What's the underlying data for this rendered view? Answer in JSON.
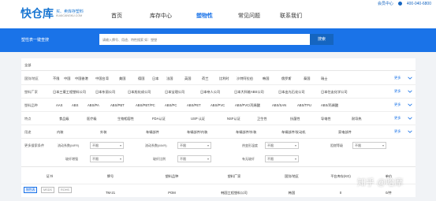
{
  "header": {
    "logo_mark": "快仓库",
    "logo_tagline": "买、卖库存塑料",
    "logo_domain": "KUAICANGKU.COM",
    "nav": [
      "首页",
      "库存中心",
      "塑物性",
      "常见问题",
      "联系我们"
    ],
    "active_nav": "塑物性",
    "member_link": "会员中心",
    "phone": "400-040-6800"
  },
  "search": {
    "title": "塑性表一键查搜",
    "placeholder": "请输入牌号、用途、特性搜索 如：塑塑",
    "button": "搜索"
  },
  "filters": {
    "all_label": "全部",
    "more_label": "更多",
    "rows": [
      {
        "label": "国别/地区",
        "options": [
          "不限",
          "中国",
          "中国香港",
          "中国台湾",
          "美国",
          "德国",
          "日本",
          "法国",
          "英国",
          "荷兰",
          "比利时",
          "沙特阿拉伯",
          "韩国",
          "俄罗斯",
          "泰国",
          "瑞士"
        ]
      },
      {
        "label": "塑料厂家",
        "options": [
          "日本三菱工程塑料公司",
          "日本东丽公司",
          "日本旭化成公司",
          "日本宝理公司",
          "日本帝人公司",
          "日本大科能ABS公司",
          "日本出光石化公司",
          "日本住友化学公司"
        ]
      },
      {
        "label": "塑料品种",
        "options": [
          "AAS",
          "ABS",
          "ABS/PA",
          "ABS/PBT",
          "ABS/PBT/PC",
          "ABS/PC",
          "ABS/PET",
          "ABS/PVC",
          "ABS/PVC/丙烯酸",
          "ABS/SAN",
          "ABS/TPU",
          "ABS/丙烯酸"
        ]
      },
      {
        "label": "特点",
        "options": [
          "食品级",
          "医疗级",
          "生物相容性",
          "FDA认证",
          "USP 认证",
          "NSF认证",
          "卫生性",
          "抗菌性",
          "导电性",
          "耐导热"
        ]
      },
      {
        "label": "用途",
        "options": [
          "内装",
          "外装",
          "车辆部件",
          "车辆部件/内装",
          "车辆部件/外装",
          "车辆部件/发动机",
          "家电部件"
        ]
      }
    ],
    "advanced": {
      "label": "更多搜索条件",
      "fields": [
        {
          "label": "流动系数(MFR)",
          "value": "不限"
        },
        {
          "label": "流动系数(MVR)",
          "value": "不限"
        },
        {
          "label": "热变形温度",
          "value": "不限"
        },
        {
          "label": "阻燃等级",
          "value": "不限"
        },
        {
          "label": "玻纤增强",
          "value": "不限"
        },
        {
          "label": "玻纤比例",
          "value": "不限"
        },
        {
          "label": "有无玻纤",
          "value": "不限"
        }
      ]
    }
  },
  "table": {
    "columns": [
      "证书",
      "牌号",
      "塑料品种",
      "塑料厂家",
      "国别/地区",
      "平台库存(KG)",
      "单价"
    ],
    "rows": [
      {
        "certs": [
          "物性表",
          "MSDS",
          "ROHS"
        ],
        "grade": "TM-21",
        "material": "POM",
        "maker": "韩国工程塑料公司",
        "region": "韩国",
        "stock": "0",
        "price": "0/件"
      }
    ]
  },
  "watermark": "知乎 @哈摩"
}
